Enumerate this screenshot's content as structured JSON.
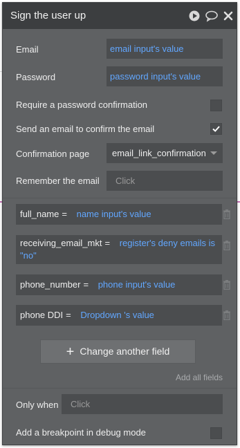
{
  "header": {
    "title": "Sign the user up"
  },
  "rows": {
    "email": {
      "label": "Email",
      "value": "email input's value"
    },
    "password": {
      "label": "Password",
      "value": "password input's value"
    },
    "require_confirmation": {
      "label": "Require a password confirmation",
      "checked": false
    },
    "send_email": {
      "label": "Send an email to confirm the email",
      "checked": true
    },
    "confirmation_page": {
      "label": "Confirmation page",
      "value": "email_link_confirmation"
    },
    "remember_email": {
      "label": "Remember the email",
      "placeholder": "Click"
    }
  },
  "fields": [
    {
      "key": "full_name",
      "value": "name input's value"
    },
    {
      "key": "receiving_email_mkt",
      "value": "register's deny emails is \"no\""
    },
    {
      "key": "phone_number",
      "value": "phone input's value"
    },
    {
      "key": "phone DDI",
      "value": "Dropdown 's value"
    }
  ],
  "equals": "=",
  "change_button": {
    "icon": "plus-icon",
    "label": "Change another field"
  },
  "add_all_label": "Add all fields",
  "only_when": {
    "label": "Only when",
    "placeholder": "Click"
  },
  "breakpoint": {
    "label": "Add a breakpoint in debug mode",
    "checked": false
  },
  "colors": {
    "panel": "#5f6163",
    "header": "#3c3e40",
    "field": "#4b4d4f",
    "dynamic_text": "#62a7ff"
  }
}
